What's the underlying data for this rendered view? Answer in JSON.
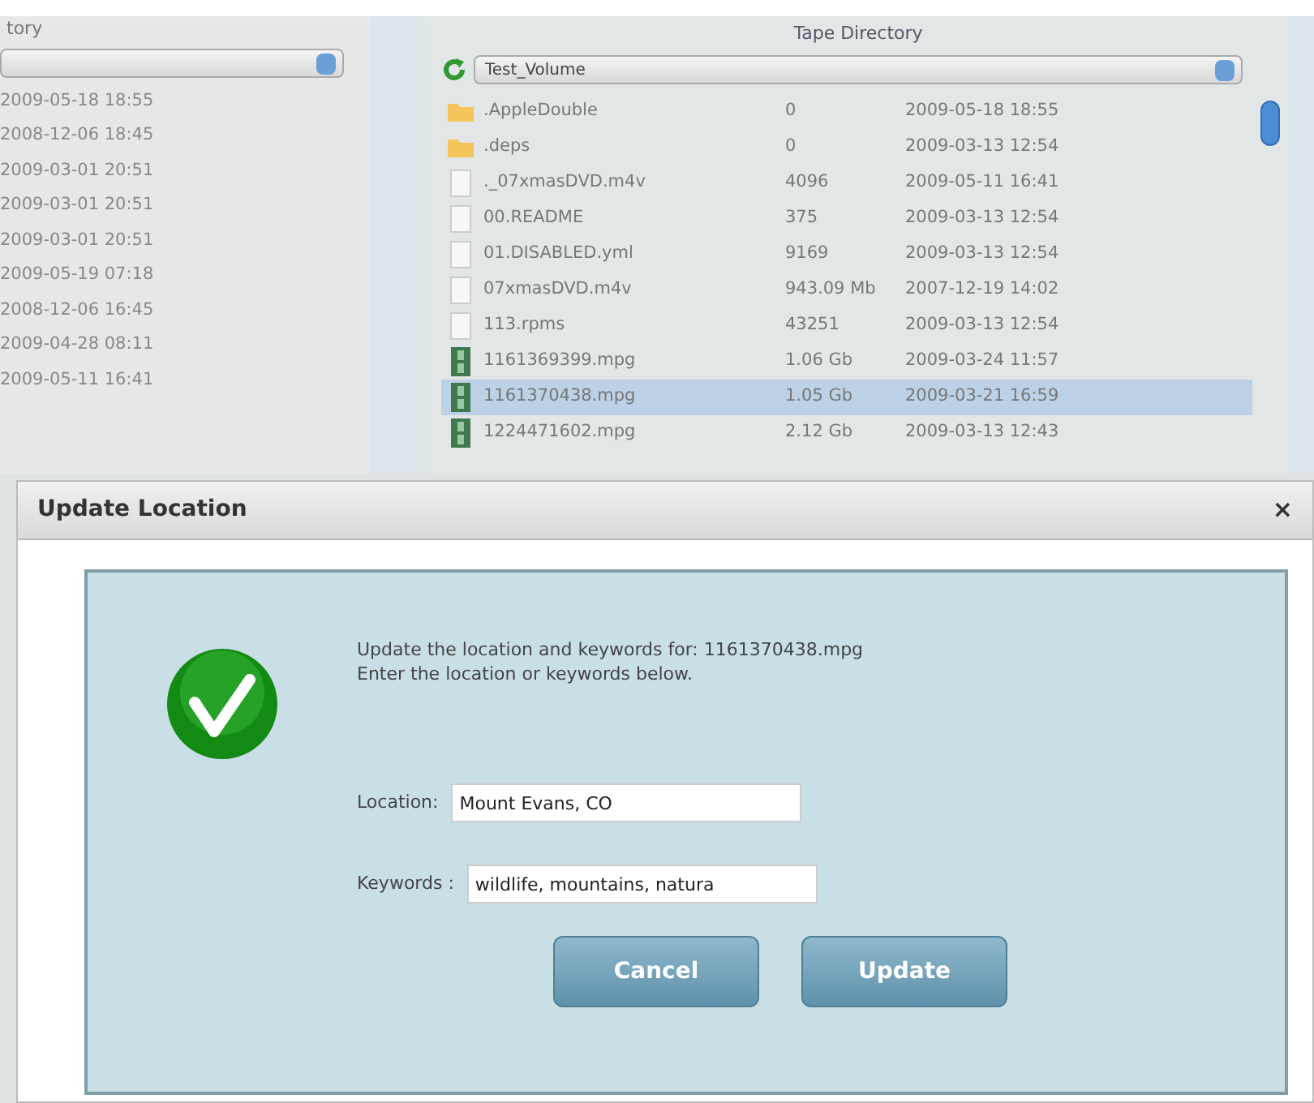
{
  "left_panel": {
    "title": "tory",
    "dates": [
      "2009-05-18 18:55",
      "2008-12-06 18:45",
      "2009-03-01 20:51",
      "2009-03-01 20:51",
      "2009-03-01 20:51",
      "2009-05-19 07:18",
      "2008-12-06 16:45",
      "2009-04-28 08:11",
      "2009-05-11 16:41"
    ]
  },
  "tape_directory": {
    "title": "Tape Directory",
    "volume": "Test_Volume",
    "rows": [
      {
        "kind": "folder",
        "name": ".AppleDouble",
        "size": "0",
        "date": "2009-05-18 18:55",
        "selected": false
      },
      {
        "kind": "folder",
        "name": ".deps",
        "size": "0",
        "date": "2009-03-13 12:54",
        "selected": false
      },
      {
        "kind": "file",
        "name": "._07xmasDVD.m4v",
        "size": "4096",
        "date": "2009-05-11 16:41",
        "selected": false
      },
      {
        "kind": "file",
        "name": "00.README",
        "size": "375",
        "date": "2009-03-13 12:54",
        "selected": false
      },
      {
        "kind": "file",
        "name": "01.DISABLED.yml",
        "size": "9169",
        "date": "2009-03-13 12:54",
        "selected": false
      },
      {
        "kind": "file",
        "name": "07xmasDVD.m4v",
        "size": "943.09 Mb",
        "date": "2007-12-19 14:02",
        "selected": false
      },
      {
        "kind": "file",
        "name": "113.rpms",
        "size": "43251",
        "date": "2009-03-13 12:54",
        "selected": false
      },
      {
        "kind": "video",
        "name": "1161369399.mpg",
        "size": "1.06 Gb",
        "date": "2009-03-24 11:57",
        "selected": false
      },
      {
        "kind": "video",
        "name": "1161370438.mpg",
        "size": "1.05 Gb",
        "date": "2009-03-21 16:59",
        "selected": true
      },
      {
        "kind": "video",
        "name": "1224471602.mpg",
        "size": "2.12 Gb",
        "date": "2009-03-13 12:43",
        "selected": false
      }
    ]
  },
  "dialog": {
    "title": "Update Location",
    "close": "×",
    "message": [
      "Update the location and keywords for: 1161370438.mpg",
      "Enter the location or keywords below."
    ],
    "fields": [
      {
        "label": "Location:",
        "value": "Mount Evans, CO"
      },
      {
        "label": "Keywords :",
        "value": "wildlife, mountains, natura"
      }
    ],
    "buttons": [
      "Cancel",
      "Update"
    ]
  }
}
